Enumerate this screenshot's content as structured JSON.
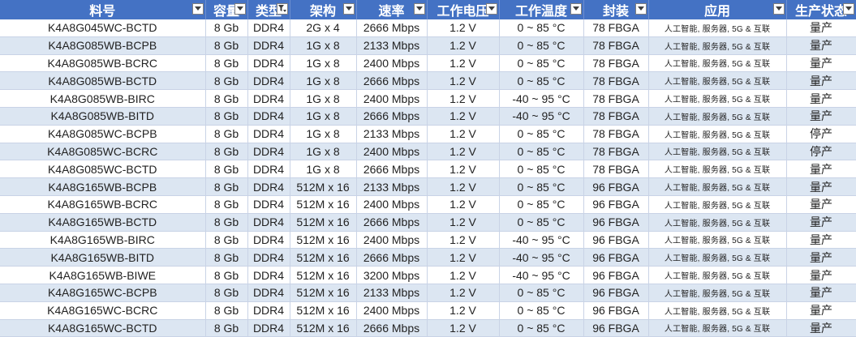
{
  "header": [
    {
      "label": "料号",
      "filter": "down"
    },
    {
      "label": "容量",
      "filter": "down"
    },
    {
      "label": "类型",
      "filter": "filtered"
    },
    {
      "label": "架构",
      "filter": "down"
    },
    {
      "label": "速率",
      "filter": "down"
    },
    {
      "label": "工作电压",
      "filter": "down"
    },
    {
      "label": "工作温度",
      "filter": "down"
    },
    {
      "label": "封装",
      "filter": "down"
    },
    {
      "label": "应用",
      "filter": "down"
    },
    {
      "label": "生产状态",
      "filter": "down"
    }
  ],
  "rows": [
    [
      "K4A8G045WC-BCTD",
      "8 Gb",
      "DDR4",
      "2G x 4",
      "2666 Mbps",
      "1.2 V",
      "0 ~ 85 °C",
      "78 FBGA",
      "人工智能, 服务器, 5G & 互联",
      "量产"
    ],
    [
      "K4A8G085WB-BCPB",
      "8 Gb",
      "DDR4",
      "1G x 8",
      "2133 Mbps",
      "1.2 V",
      "0 ~ 85 °C",
      "78 FBGA",
      "人工智能, 服务器, 5G & 互联",
      "量产"
    ],
    [
      "K4A8G085WB-BCRC",
      "8 Gb",
      "DDR4",
      "1G x 8",
      "2400 Mbps",
      "1.2 V",
      "0 ~ 85 °C",
      "78 FBGA",
      "人工智能, 服务器, 5G & 互联",
      "量产"
    ],
    [
      "K4A8G085WB-BCTD",
      "8 Gb",
      "DDR4",
      "1G x 8",
      "2666 Mbps",
      "1.2 V",
      "0 ~ 85 °C",
      "78 FBGA",
      "人工智能, 服务器, 5G & 互联",
      "量产"
    ],
    [
      "K4A8G085WB-BIRC",
      "8 Gb",
      "DDR4",
      "1G x 8",
      "2400 Mbps",
      "1.2 V",
      "-40 ~ 95 °C",
      "78 FBGA",
      "人工智能, 服务器, 5G & 互联",
      "量产"
    ],
    [
      "K4A8G085WB-BITD",
      "8 Gb",
      "DDR4",
      "1G x 8",
      "2666 Mbps",
      "1.2 V",
      "-40 ~ 95 °C",
      "78 FBGA",
      "人工智能, 服务器, 5G & 互联",
      "量产"
    ],
    [
      "K4A8G085WC-BCPB",
      "8 Gb",
      "DDR4",
      "1G x 8",
      "2133 Mbps",
      "1.2 V",
      "0 ~ 85 °C",
      "78 FBGA",
      "人工智能, 服务器, 5G & 互联",
      "停产"
    ],
    [
      "K4A8G085WC-BCRC",
      "8 Gb",
      "DDR4",
      "1G x 8",
      "2400 Mbps",
      "1.2 V",
      "0 ~ 85 °C",
      "78 FBGA",
      "人工智能, 服务器, 5G & 互联",
      "停产"
    ],
    [
      "K4A8G085WC-BCTD",
      "8 Gb",
      "DDR4",
      "1G x 8",
      "2666 Mbps",
      "1.2 V",
      "0 ~ 85 °C",
      "78 FBGA",
      "人工智能, 服务器, 5G & 互联",
      "量产"
    ],
    [
      "K4A8G165WB-BCPB",
      "8 Gb",
      "DDR4",
      "512M x 16",
      "2133 Mbps",
      "1.2 V",
      "0 ~ 85 °C",
      "96 FBGA",
      "人工智能, 服务器, 5G & 互联",
      "量产"
    ],
    [
      "K4A8G165WB-BCRC",
      "8 Gb",
      "DDR4",
      "512M x 16",
      "2400 Mbps",
      "1.2 V",
      "0 ~ 85 °C",
      "96 FBGA",
      "人工智能, 服务器, 5G & 互联",
      "量产"
    ],
    [
      "K4A8G165WB-BCTD",
      "8 Gb",
      "DDR4",
      "512M x 16",
      "2666 Mbps",
      "1.2 V",
      "0 ~ 85 °C",
      "96 FBGA",
      "人工智能, 服务器, 5G & 互联",
      "量产"
    ],
    [
      "K4A8G165WB-BIRC",
      "8 Gb",
      "DDR4",
      "512M x 16",
      "2400 Mbps",
      "1.2 V",
      "-40 ~ 95 °C",
      "96 FBGA",
      "人工智能, 服务器, 5G & 互联",
      "量产"
    ],
    [
      "K4A8G165WB-BITD",
      "8 Gb",
      "DDR4",
      "512M x 16",
      "2666 Mbps",
      "1.2 V",
      "-40 ~ 95 °C",
      "96 FBGA",
      "人工智能, 服务器, 5G & 互联",
      "量产"
    ],
    [
      "K4A8G165WB-BIWE",
      "8 Gb",
      "DDR4",
      "512M x 16",
      "3200 Mbps",
      "1.2 V",
      "-40 ~ 95 °C",
      "96 FBGA",
      "人工智能, 服务器, 5G & 互联",
      "量产"
    ],
    [
      "K4A8G165WC-BCPB",
      "8 Gb",
      "DDR4",
      "512M x 16",
      "2133 Mbps",
      "1.2 V",
      "0 ~ 85 °C",
      "96 FBGA",
      "人工智能, 服务器, 5G & 互联",
      "量产"
    ],
    [
      "K4A8G165WC-BCRC",
      "8 Gb",
      "DDR4",
      "512M x 16",
      "2400 Mbps",
      "1.2 V",
      "0 ~ 85 °C",
      "96 FBGA",
      "人工智能, 服务器, 5G & 互联",
      "量产"
    ],
    [
      "K4A8G165WC-BCTD",
      "8 Gb",
      "DDR4",
      "512M x 16",
      "2666 Mbps",
      "1.2 V",
      "0 ~ 85 °C",
      "96 FBGA",
      "人工智能, 服务器, 5G & 互联",
      "量产"
    ]
  ],
  "colors": {
    "header_bg": "#4472c4",
    "band_bg": "#dce6f2",
    "grid": "#c9d3e6"
  }
}
